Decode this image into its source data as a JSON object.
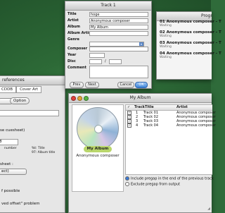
{
  "colors": {
    "close": "#e0413a",
    "minimize": "#e4a432",
    "zoom": "#58b444",
    "accent": "#3e84d8"
  },
  "prefs": {
    "title": "references",
    "tabs": [
      "CDDB",
      "Cover Art"
    ],
    "option_label": "Option",
    "cuesheet_text": "se cuesheet)",
    "number_line": "number",
    "album_title_line": "97: Album title",
    "title_line": "%t: Title",
    "sheet_label": "sheet :",
    "select_value": "ect)",
    "f_possible": "f possible",
    "offset_problem": "ved offset\" problem",
    "field_value": "8"
  },
  "track_window": {
    "title": "Track 1",
    "fields": [
      {
        "label": "Title",
        "value": "hoge"
      },
      {
        "label": "Artist",
        "value": "Anonymous composer"
      },
      {
        "label": "Album",
        "value": "My Album"
      },
      {
        "label": "Album Artist",
        "value": ""
      },
      {
        "label": "Genre",
        "value": ""
      },
      {
        "label": "Composer",
        "value": ""
      },
      {
        "label": "Year",
        "value": ""
      },
      {
        "label": "Disc",
        "value": ""
      },
      {
        "label": "Comment",
        "value": ""
      }
    ],
    "disc_separator": "/",
    "buttons": {
      "prev": "Prev",
      "next": "Next",
      "cancel": "Cancel",
      "ok": "OK"
    }
  },
  "progress_window": {
    "title": "Progr",
    "items": [
      {
        "name": "01 Anonymous composer - T",
        "status": "Waiting"
      },
      {
        "name": "02 Anonymous composer - T",
        "status": "Waiting"
      },
      {
        "name": "03 Anonymous composer - T",
        "status": "Waiting"
      },
      {
        "name": "04 Anonymous composer - T",
        "status": "Waiting"
      }
    ]
  },
  "album_window": {
    "title": "My Album",
    "album_name": "My Album",
    "album_artist": "Anonymous composer",
    "columns": [
      "Track",
      "Title",
      "Artist"
    ],
    "tracks": [
      {
        "number": "1",
        "title": "Track 01",
        "artist": "Anonymous composer"
      },
      {
        "number": "2",
        "title": "Track 02",
        "artist": "Anonymous composer"
      },
      {
        "number": "3",
        "title": "Track 03",
        "artist": "Anonymous composer"
      },
      {
        "number": "4",
        "title": "Track 04",
        "artist": "Anonymous composer"
      }
    ],
    "options": [
      {
        "label": "Include pregap in the end of the previous track",
        "selected": true
      },
      {
        "label": "Exclude pregap from output",
        "selected": false
      }
    ]
  }
}
